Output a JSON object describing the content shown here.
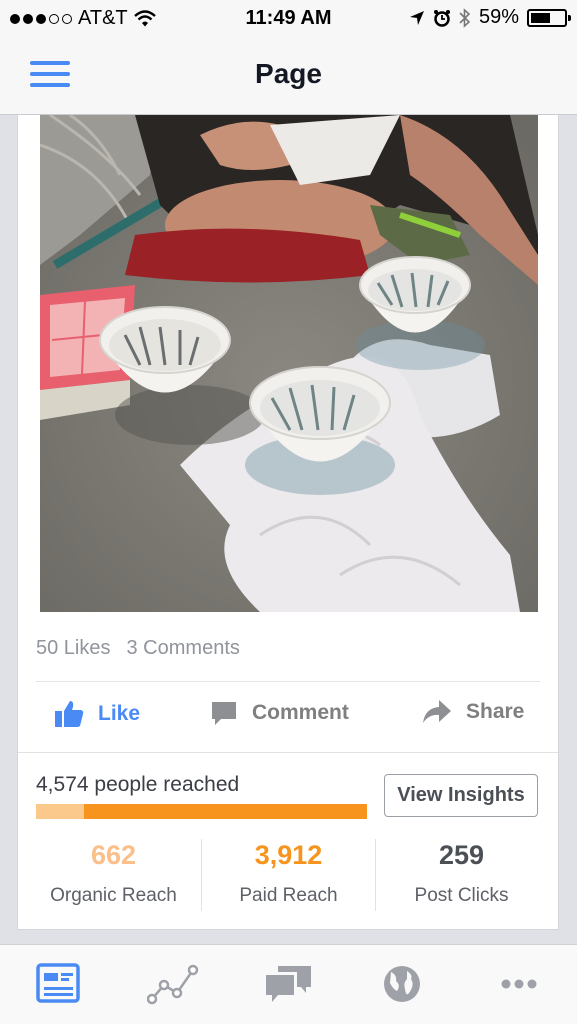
{
  "status_bar": {
    "carrier": "AT&T",
    "time": "11:49 AM",
    "battery": "59%",
    "battery_level": 0.59
  },
  "nav": {
    "title": "Page",
    "menu_icon": "hamburger-menu-icon",
    "accent": "#4a8af4"
  },
  "post": {
    "photo_alt": "three ceramic bowls with skeletal hand prints",
    "likes": "50 Likes",
    "comments": "3 Comments",
    "actions": {
      "like": "Like",
      "comment": "Comment",
      "share": "Share"
    },
    "reach": {
      "label": "4,574 people reached",
      "organic_fraction": 0.145,
      "button": "View Insights"
    },
    "metrics": [
      {
        "value": "662",
        "label": "Organic Reach",
        "color": "#fbc08a"
      },
      {
        "value": "3,912",
        "label": "Paid Reach",
        "color": "#f7941d"
      },
      {
        "value": "259",
        "label": "Post Clicks",
        "color": "#4b4f56"
      }
    ]
  },
  "tab_bar": {
    "tabs": [
      "news-feed-icon",
      "insights-graph-icon",
      "messages-icon",
      "globe-icon",
      "more-icon"
    ],
    "active_color": "#4a8af4",
    "inactive_color": "#9ea2a8"
  }
}
